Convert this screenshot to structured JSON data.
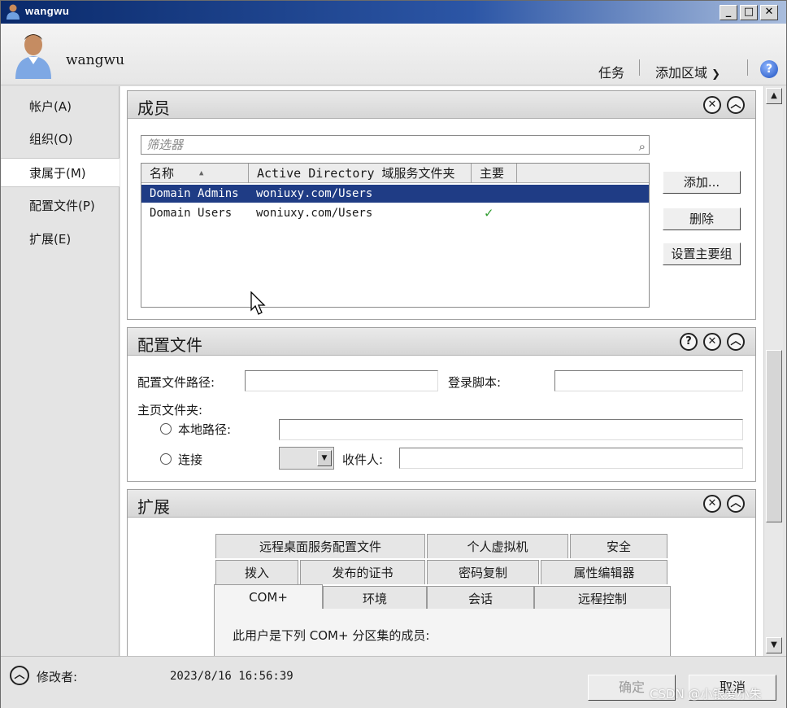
{
  "window": {
    "title": "wangwu"
  },
  "header": {
    "username": "wangwu",
    "tasks_label": "任务",
    "add_area_label": "添加区域"
  },
  "nav": {
    "items": [
      {
        "label": "帐户(A)"
      },
      {
        "label": "组织(O)"
      },
      {
        "label": "隶属于(M)"
      },
      {
        "label": "配置文件(P)"
      },
      {
        "label": "扩展(E)"
      }
    ]
  },
  "members": {
    "title": "成员",
    "filter_placeholder": "筛选器",
    "columns": [
      "名称",
      "Active Directory 域服务文件夹",
      "主要"
    ],
    "rows": [
      {
        "name": "Domain Admins",
        "folder": "woniuxy.com/Users",
        "primary": ""
      },
      {
        "name": "Domain Users",
        "folder": "woniuxy.com/Users",
        "primary": "✓"
      }
    ],
    "add_button": "添加...",
    "remove_button": "删除",
    "set_primary_button": "设置主要组"
  },
  "profile": {
    "title": "配置文件",
    "profile_path_label": "配置文件路径:",
    "profile_path_value": "",
    "logon_script_label": "登录脚本:",
    "logon_script_value": "",
    "home_folder_label": "主页文件夹:",
    "local_path_label": "本地路径:",
    "local_path_value": "",
    "connect_label": "连接",
    "recipient_label": "收件人:",
    "recipient_value": ""
  },
  "extensions": {
    "title": "扩展",
    "tabs_row1": [
      "远程桌面服务配置文件",
      "个人虚拟机",
      "安全"
    ],
    "tabs_row2": [
      "拨入",
      "发布的证书",
      "密码复制",
      "属性编辑器"
    ],
    "tabs_row3": [
      "COM+",
      "环境",
      "会话",
      "远程控制"
    ],
    "panel_text": "此用户是下列 COM+ 分区集的成员:"
  },
  "footer": {
    "modified_by_label": "修改者:",
    "timestamp": "2023/8/16 16:56:39",
    "ok_button": "确定",
    "cancel_button": "取消",
    "watermark": "CSDN @小银爱小朱"
  }
}
